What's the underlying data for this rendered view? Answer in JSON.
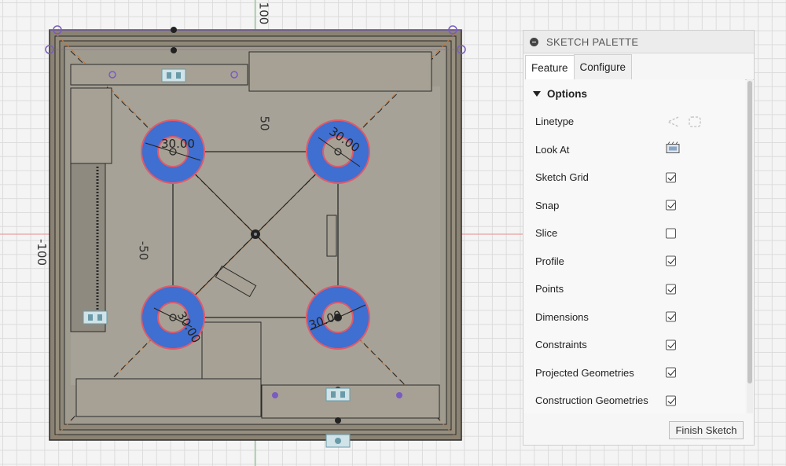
{
  "canvas": {
    "axis_labels": {
      "top": "100",
      "left": "-100",
      "inner_vertical": "50",
      "inner_horizontal": "-50"
    },
    "dimension_texts": [
      "30.00",
      "30.00",
      "30.00",
      "30.00"
    ],
    "colors": {
      "grid": "#dcdcdc",
      "x_axis": "#e8a0a0",
      "y_axis": "#7ccf7c",
      "enclosure": "#8a8272",
      "boss_fill": "#3f6fd0",
      "boss_ring": "#e05a6a",
      "constraint_point": "#7a5bbf"
    }
  },
  "palette": {
    "title": "SKETCH PALETTE",
    "tabs": [
      {
        "label": "Feature",
        "active": true
      },
      {
        "label": "Configure",
        "active": false
      }
    ],
    "section_title": "Options",
    "options": [
      {
        "label": "Linetype",
        "control": "linetype-icons"
      },
      {
        "label": "Look At",
        "control": "look-at-icon"
      },
      {
        "label": "Sketch Grid",
        "control": "checkbox",
        "checked": true
      },
      {
        "label": "Snap",
        "control": "checkbox",
        "checked": true
      },
      {
        "label": "Slice",
        "control": "checkbox",
        "checked": false
      },
      {
        "label": "Profile",
        "control": "checkbox",
        "checked": true
      },
      {
        "label": "Points",
        "control": "checkbox",
        "checked": true
      },
      {
        "label": "Dimensions",
        "control": "checkbox",
        "checked": true
      },
      {
        "label": "Constraints",
        "control": "checkbox",
        "checked": true
      },
      {
        "label": "Projected Geometries",
        "control": "checkbox",
        "checked": true
      },
      {
        "label": "Construction Geometries",
        "control": "checkbox",
        "checked": true
      }
    ],
    "finish_label": "Finish Sketch"
  }
}
